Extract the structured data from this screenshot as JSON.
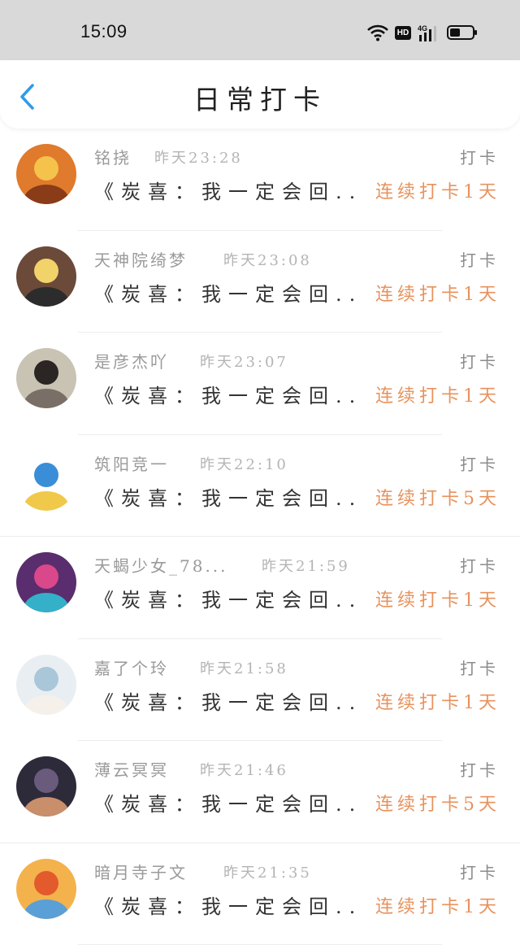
{
  "status_bar": {
    "time": "15:09",
    "network_label": "4G",
    "hd_label": "HD"
  },
  "nav": {
    "title": "日常打卡",
    "back_icon": "chevron-left-icon",
    "accent_color": "#2f9be8"
  },
  "colors": {
    "streak": "#e8925c",
    "meta": "#9a9a9a",
    "content": "#333333"
  },
  "checkins": [
    {
      "username": "铭挠",
      "time": "昨天23:28",
      "action": "打卡",
      "content": "《炭喜：我一定会回...",
      "streak": "连续打卡1天"
    },
    {
      "username": "天神院绮梦",
      "time": "昨天23:08",
      "action": "打卡",
      "content": "《炭喜：我一定会回...",
      "streak": "连续打卡1天"
    },
    {
      "username": "是彦杰吖",
      "time": "昨天23:07",
      "action": "打卡",
      "content": "《炭喜：我一定会回...",
      "streak": "连续打卡1天"
    },
    {
      "username": "筑阳竞一",
      "time": "昨天22:10",
      "action": "打卡",
      "content": "《炭喜：我一定会回...",
      "streak": "连续打卡5天"
    },
    {
      "username": "天蝎少女_78...",
      "time": "昨天21:59",
      "action": "打卡",
      "content": "《炭喜：我一定会回...",
      "streak": "连续打卡1天"
    },
    {
      "username": "嘉了个玲",
      "time": "昨天21:58",
      "action": "打卡",
      "content": "《炭喜：我一定会回...",
      "streak": "连续打卡1天"
    },
    {
      "username": "薄云冥冥",
      "time": "昨天21:46",
      "action": "打卡",
      "content": "《炭喜：我一定会回...",
      "streak": "连续打卡5天"
    },
    {
      "username": "暗月寺子文",
      "time": "昨天21:35",
      "action": "打卡",
      "content": "《炭喜：我一定会回...",
      "streak": "连续打卡1天"
    }
  ]
}
